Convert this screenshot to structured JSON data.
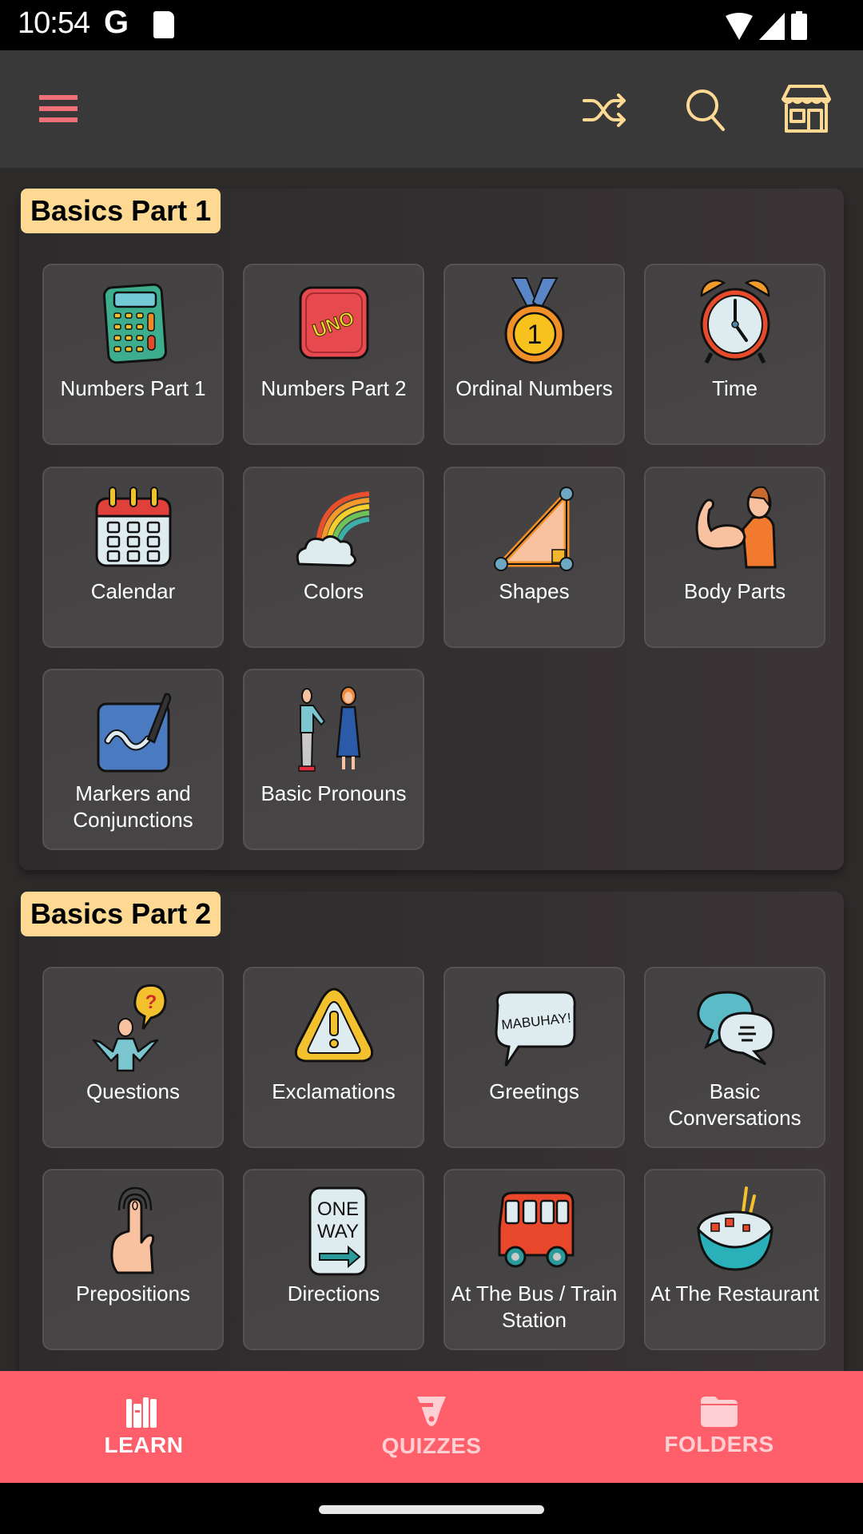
{
  "status_bar": {
    "time": "10:54",
    "carrier_icon": "google-g-icon",
    "sd_icon": "sd-card-icon",
    "wifi_icon": "wifi-icon",
    "signal_icon": "signal-icon",
    "battery_icon": "battery-icon"
  },
  "app_bar": {
    "menu_icon": "hamburger-menu-icon",
    "shuffle_icon": "shuffle-icon",
    "search_icon": "search-icon",
    "store_icon": "store-icon",
    "colors": {
      "menu": "#f0707a",
      "actions": "#fdd994"
    }
  },
  "sections": [
    {
      "title": "Basics Part 1",
      "tiles": [
        {
          "label": "Numbers Part 1",
          "icon": "calculator-icon"
        },
        {
          "label": "Numbers Part 2",
          "icon": "uno-card-icon"
        },
        {
          "label": "Ordinal Numbers",
          "icon": "medal-icon"
        },
        {
          "label": "Time",
          "icon": "alarm-clock-icon"
        },
        {
          "label": "Calendar",
          "icon": "calendar-icon"
        },
        {
          "label": "Colors",
          "icon": "rainbow-icon"
        },
        {
          "label": "Shapes",
          "icon": "triangle-shape-icon"
        },
        {
          "label": "Body Parts",
          "icon": "flexing-arm-icon"
        },
        {
          "label": "Markers and Conjunctions",
          "icon": "marker-board-icon"
        },
        {
          "label": "Basic Pronouns",
          "icon": "two-people-icon"
        }
      ]
    },
    {
      "title": "Basics Part 2",
      "tiles": [
        {
          "label": "Questions",
          "icon": "question-person-icon"
        },
        {
          "label": "Exclamations",
          "icon": "warning-sign-icon"
        },
        {
          "label": "Greetings",
          "icon": "speech-bubble-icon",
          "icon_text": "MABUHAY!"
        },
        {
          "label": "Basic Conversations",
          "icon": "chat-bubbles-icon"
        },
        {
          "label": "Prepositions",
          "icon": "pointing-finger-icon"
        },
        {
          "label": "Directions",
          "icon": "one-way-sign-icon",
          "icon_text": "ONE WAY"
        },
        {
          "label": "At The Bus / Train Station",
          "icon": "bus-icon"
        },
        {
          "label": "At The Restaurant",
          "icon": "noodle-bowl-icon"
        }
      ]
    }
  ],
  "bottom_nav": {
    "items": [
      {
        "label": "LEARN",
        "icon": "books-icon",
        "active": true
      },
      {
        "label": "QUIZZES",
        "icon": "quiz-icon",
        "active": false
      },
      {
        "label": "FOLDERS",
        "icon": "folder-icon",
        "active": false
      }
    ],
    "background": "#ff5f6b"
  }
}
